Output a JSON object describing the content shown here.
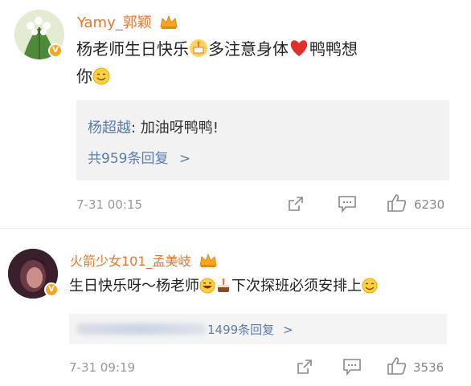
{
  "comments": [
    {
      "username": "Yamy_郭颖",
      "text_part1": "杨老师生日快乐",
      "text_part2": "多注意身体",
      "text_part3": "鸭鸭想",
      "text_line2": "你",
      "reply": {
        "author": "杨超越",
        "separator": ":",
        "text": " 加油呀鸭鸭!"
      },
      "reply_count": "共959条回复",
      "reply_chevron": ">",
      "timestamp": "7-31 00:15",
      "likes": "6230"
    },
    {
      "username": "火箭少女101_孟美岐",
      "text_part1": "生日快乐呀～杨老师",
      "text_part2": "下次探班必须安排上",
      "reply_count": "1499条回复",
      "reply_chevron": ">",
      "timestamp": "7-31 09:19",
      "likes": "3536"
    }
  ],
  "icons": [
    "verified-badge-icon",
    "crown-icon",
    "share-icon",
    "comment-icon",
    "like-icon",
    "cake-emoji-icon",
    "heart-emoji-icon",
    "smile-emoji-icon",
    "grin-emoji-icon"
  ],
  "colors": {
    "username": "#e8762c",
    "reply_link": "#5a7dab",
    "reply_bg": "#f2f2f2",
    "meta": "#999999",
    "heart": "#e0302a"
  }
}
